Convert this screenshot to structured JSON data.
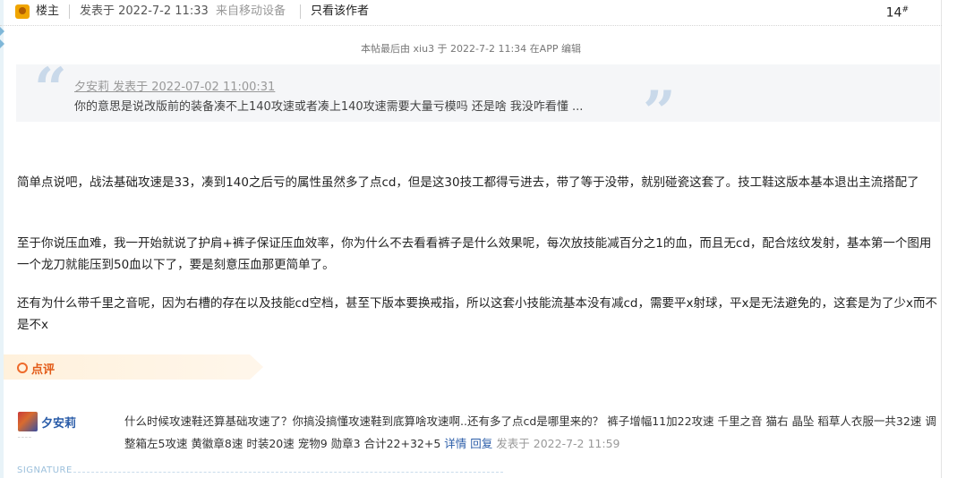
{
  "header": {
    "role": "楼主",
    "posted_at": "发表于 2022-7-2 11:33",
    "device": "来自移动设备",
    "author_only": "只看该作者",
    "floor": "14",
    "floor_mark": "#"
  },
  "edit_note": "本帖最后由 xiu3 于 2022-7-2 11:34 在APP 编辑",
  "quote": {
    "author_line": "夕安莉 发表于 2022-07-02 11:00:31",
    "text": "你的意思是说改版前的装备凑不上140攻速或者凑上140攻速需要大量亏模吗 还是啥 我没咋看懂 ..."
  },
  "body": {
    "p1": "简单点说吧，战法基础攻速是33，凑到140之后亏的属性虽然多了点cd，但是这30技工都得亏进去，带了等于没带，就别碰瓷这套了。技工鞋这版本基本退出主流搭配了",
    "p2": "至于你说压血难，我一开始就说了护肩+裤子保证压血效率，你为什么不去看看裤子是什么效果呢，每次放技能减百分之1的血，而且无cd，配合炫纹发射，基本第一个图用一个龙刀就能压到50血以下了，要是刻意压血那更简单了。",
    "p3": "还有为什么带千里之音呢，因为右槽的存在以及技能cd空档，甚至下版本要换戒指，所以这套小技能流基本没有减cd，需要平x射球，平x是无法避免的，这套是为了少x而不是不x"
  },
  "comment_section": {
    "label": "点评"
  },
  "comment": {
    "author": "夕安莉",
    "text": "什么时候攻速鞋还算基础攻速了？你搞没搞懂攻速鞋到底算啥攻速啊..还有多了点cd是哪里来的？ 裤子增幅11加22攻速 千里之音 猫右 晶坠 稻草人衣服一共32速 调整箱左5攻速 黄徽章8速 时装20速 宠物9 勋章3 合计22+32+5",
    "detail_link": "详情",
    "reply_link": "回复",
    "time": "发表于 2022-7-2 11:59"
  },
  "signature_label": "SIGNATURE"
}
